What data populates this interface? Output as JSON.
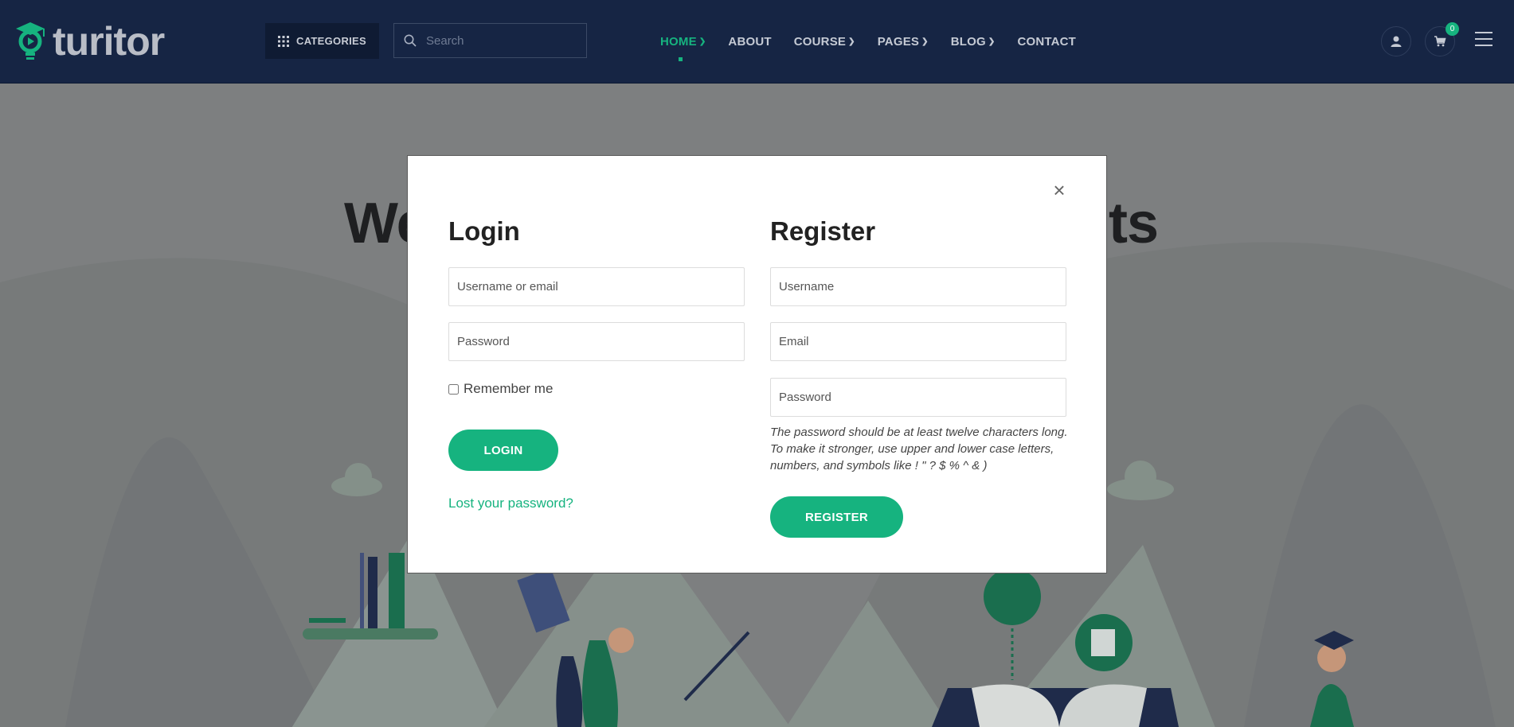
{
  "header": {
    "logo_text": "turitor",
    "categories_label": "CATEGORIES",
    "search_placeholder": "Search",
    "nav": [
      {
        "label": "HOME",
        "has_dropdown": true,
        "active": true
      },
      {
        "label": "ABOUT",
        "has_dropdown": false
      },
      {
        "label": "COURSE",
        "has_dropdown": true
      },
      {
        "label": "PAGES",
        "has_dropdown": true
      },
      {
        "label": "BLOG",
        "has_dropdown": true
      },
      {
        "label": "CONTACT",
        "has_dropdown": false
      }
    ],
    "cart_count": "0"
  },
  "hero": {
    "title_left": "We",
    "title_right": "nts"
  },
  "modal": {
    "close_label": "×",
    "login": {
      "title": "Login",
      "username_placeholder": "Username or email",
      "password_placeholder": "Password",
      "remember_label": "Remember me",
      "button_label": "LOGIN",
      "lost_password_link": "Lost your password?"
    },
    "register": {
      "title": "Register",
      "username_placeholder": "Username",
      "email_placeholder": "Email",
      "password_placeholder": "Password",
      "hint": "The password should be at least twelve characters long. To make it stronger, use upper and lower case letters, numbers, and symbols like ! \" ? $ % ^ & )",
      "button_label": "REGISTER"
    }
  },
  "colors": {
    "brand_green": "#16b37f",
    "header_bg": "#162544",
    "overlay_bg": "#7d7f80"
  }
}
